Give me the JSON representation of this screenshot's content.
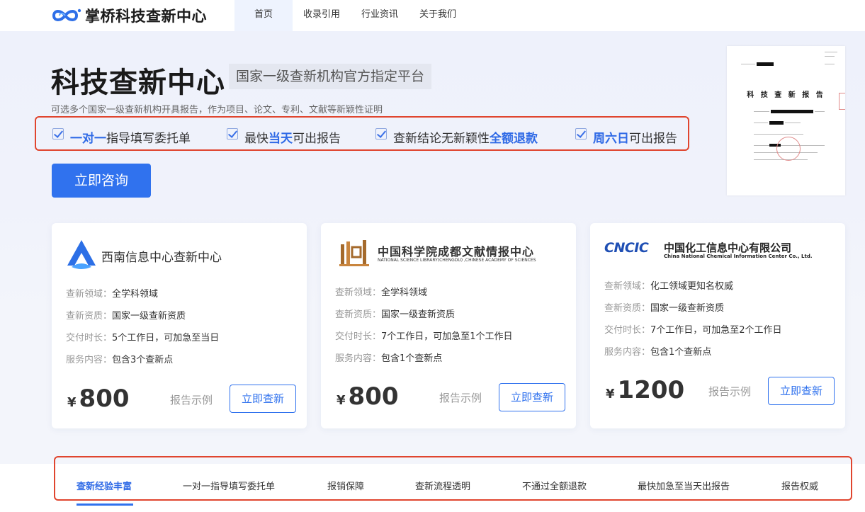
{
  "brand": {
    "name": "掌桥科技查新中心"
  },
  "nav": {
    "items": [
      {
        "label": "首页",
        "active": true
      },
      {
        "label": "收录引用",
        "active": false
      },
      {
        "label": "行业资讯",
        "active": false
      },
      {
        "label": "关于我们",
        "active": false
      }
    ]
  },
  "hero": {
    "title": "科技查新中心",
    "tag": "国家一级查新机构官方指定平台",
    "subtitle": "可选多个国家一级查新机构开具报告，作为项目、论文、专利、文献等新颖性证明",
    "features": [
      {
        "pre": "",
        "hl": "一对一",
        "post": "指导填写委托单"
      },
      {
        "pre": "最快",
        "hl": "当天",
        "post": "可出报告"
      },
      {
        "pre": "查新结论无新颖性",
        "hl": "全额退款",
        "post": ""
      },
      {
        "pre": "",
        "hl": "周六日",
        "post": "可出报告"
      }
    ],
    "cta": "立即咨询",
    "report_title": "科 技 查 新 报 告"
  },
  "cards": [
    {
      "name": "西南信息中心查新中心",
      "rows": [
        {
          "k": "查新领域：",
          "v": "全学科领域"
        },
        {
          "k": "查新资质：",
          "v": "国家一级查新资质"
        },
        {
          "k": "交付时长：",
          "v": "5个工作日，可加急至当日"
        },
        {
          "k": "服务内容：",
          "v": "包含3个查新点"
        }
      ],
      "currency": "¥",
      "price": "800",
      "sample": "报告示例",
      "button": "立即查新"
    },
    {
      "name": "中国科学院成都文献情报中心",
      "name_en": "NATIONAL SCIENCE LIBRARY(CHENGDU) ,CHINESE ACADEMY OF SCIENCES",
      "rows": [
        {
          "k": "查新领域：",
          "v": "全学科领域"
        },
        {
          "k": "查新资质：",
          "v": "国家一级查新资质"
        },
        {
          "k": "交付时长：",
          "v": "7个工作日，可加急至1个工作日"
        },
        {
          "k": "服务内容：",
          "v": "包含1个查新点"
        }
      ],
      "currency": "¥",
      "price": "800",
      "sample": "报告示例",
      "button": "立即查新"
    },
    {
      "name": "中国化工信息中心有限公司",
      "name_en": "China National Chemical Information Center Co., Ltd.",
      "logo_word": "CNCIC",
      "rows": [
        {
          "k": "查新领域：",
          "v": "化工领域更知名权威"
        },
        {
          "k": "查新资质：",
          "v": "国家一级查新资质"
        },
        {
          "k": "交付时长：",
          "v": "7个工作日，可加急至2个工作日"
        },
        {
          "k": "服务内容：",
          "v": "包含1个查新点"
        }
      ],
      "currency": "¥",
      "price": "1200",
      "sample": "报告示例",
      "button": "立即查新"
    }
  ],
  "tabs": [
    {
      "label": "查新经验丰富",
      "active": true
    },
    {
      "label": "一对一指导填写委托单",
      "active": false
    },
    {
      "label": "报销保障",
      "active": false
    },
    {
      "label": "查新流程透明",
      "active": false
    },
    {
      "label": "不通过全额退款",
      "active": false
    },
    {
      "label": "最快加急至当天出报告",
      "active": false
    },
    {
      "label": "报告权威",
      "active": false
    }
  ],
  "colors": {
    "accent": "#3072ee",
    "highlight_box": "#e0452e"
  }
}
